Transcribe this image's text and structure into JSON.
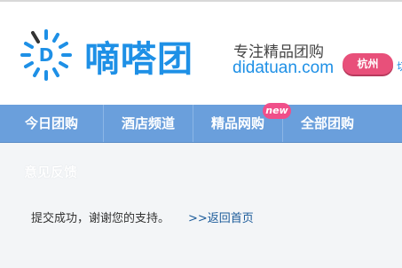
{
  "brand": {
    "logo_text": "嘀嗒团",
    "logo_letter": "D",
    "slogan": "专注精品团购",
    "domain": "didatuan.com"
  },
  "city": {
    "current": "杭州",
    "switch_label": "切"
  },
  "nav": {
    "items": [
      {
        "label": "今日团购"
      },
      {
        "label": "酒店频道"
      },
      {
        "label": "精品网购"
      },
      {
        "label": "全部团购"
      }
    ],
    "new_badge": "new"
  },
  "content": {
    "title": "意见反馈",
    "message": "提交成功，谢谢您的支持。",
    "back_link": ">>返回首页"
  },
  "colors": {
    "brand_blue": "#1e90e6",
    "nav_bg": "#6a9fdc",
    "badge_pink": "#e8507a"
  }
}
